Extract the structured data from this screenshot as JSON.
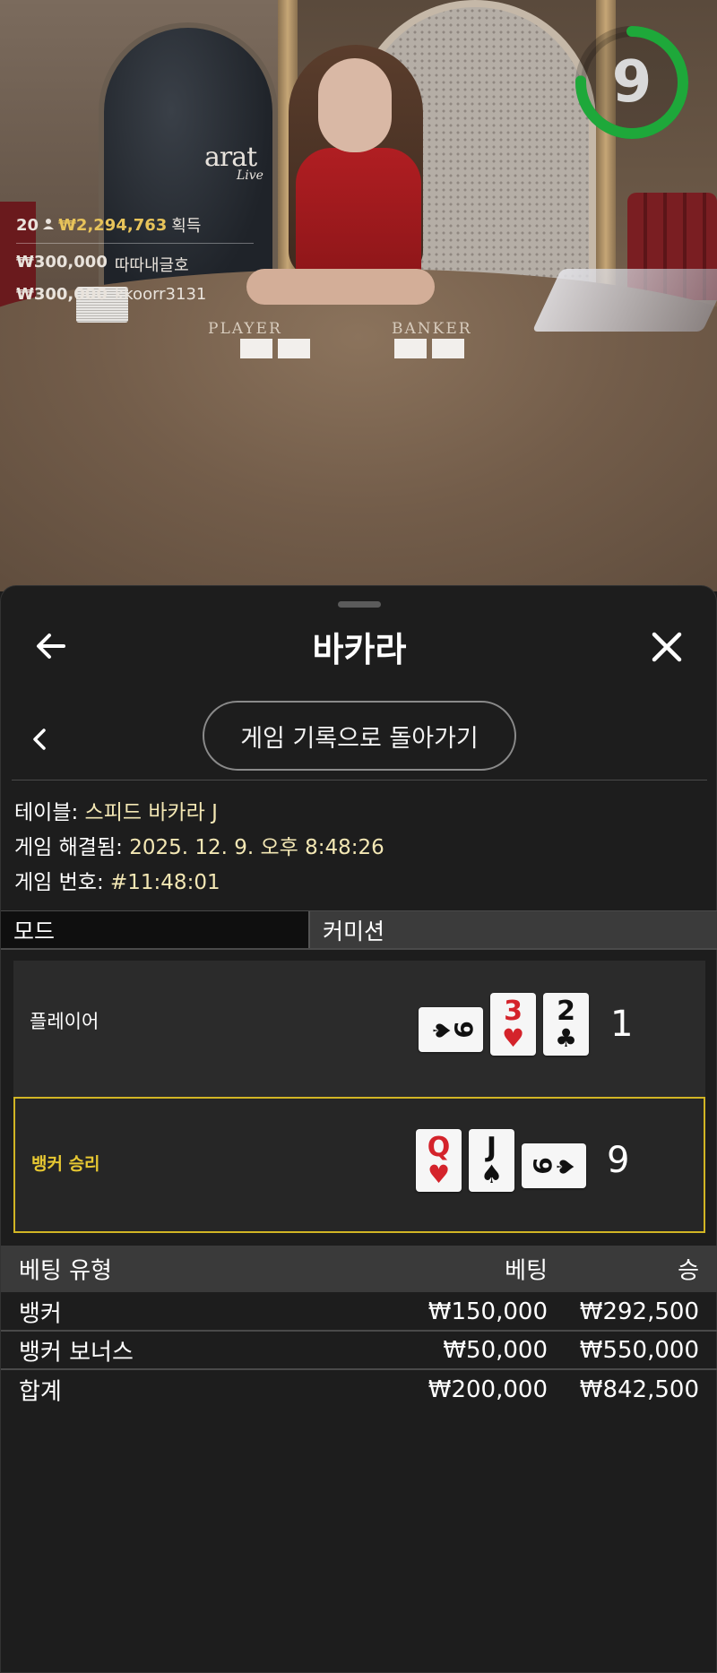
{
  "video": {
    "logo_text": "arat",
    "logo_sub": "Live",
    "table_player_label": "PLAYER",
    "table_banker_label": "BANKER",
    "timer": "9",
    "timer_color": "#1ea83a",
    "winners": {
      "count": "20",
      "amount": "₩2,294,763",
      "suffix": "획득",
      "rows": [
        {
          "amount": "₩300,000",
          "name": "따따내글호"
        },
        {
          "amount": "₩300,000",
          "name": "kkoorr3131"
        }
      ]
    }
  },
  "panel": {
    "title": "바카라",
    "back_to_history": "게임 기록으로 돌아가기",
    "info": {
      "table_label": "테이블:",
      "table_value": "스피드 바카라 J",
      "resolved_label": "게임 해결됨:",
      "resolved_value": "2025. 12. 9. 오후 8:48:26",
      "number_label": "게임 번호:",
      "number_value": "#11:48:01"
    },
    "tabs": {
      "mode": "모드",
      "commission": "커미션"
    },
    "player": {
      "label": "플레이어",
      "total": "1",
      "cards": [
        {
          "rank": "9",
          "suit": "♠",
          "color": "black",
          "orientation": "horizontal"
        },
        {
          "rank": "3",
          "suit": "♥",
          "color": "red",
          "orientation": "vertical"
        },
        {
          "rank": "2",
          "suit": "♣",
          "color": "black",
          "orientation": "vertical"
        }
      ]
    },
    "banker": {
      "label": "뱅커 승리",
      "total": "9",
      "highlight_color": "#d1b524",
      "cards": [
        {
          "rank": "Q",
          "suit": "♥",
          "color": "red",
          "orientation": "vertical"
        },
        {
          "rank": "J",
          "suit": "♠",
          "color": "black",
          "orientation": "vertical"
        },
        {
          "rank": "9",
          "suit": "♠",
          "color": "black",
          "orientation": "horizontal"
        }
      ]
    },
    "bets": {
      "headers": {
        "type": "베팅 유형",
        "bet": "베팅",
        "win": "승"
      },
      "rows": [
        {
          "type": "뱅커",
          "bet": "₩150,000",
          "win": "₩292,500"
        },
        {
          "type": "뱅커 보너스",
          "bet": "₩50,000",
          "win": "₩550,000"
        }
      ],
      "total": {
        "type": "합계",
        "bet": "₩200,000",
        "win": "₩842,500"
      }
    }
  }
}
